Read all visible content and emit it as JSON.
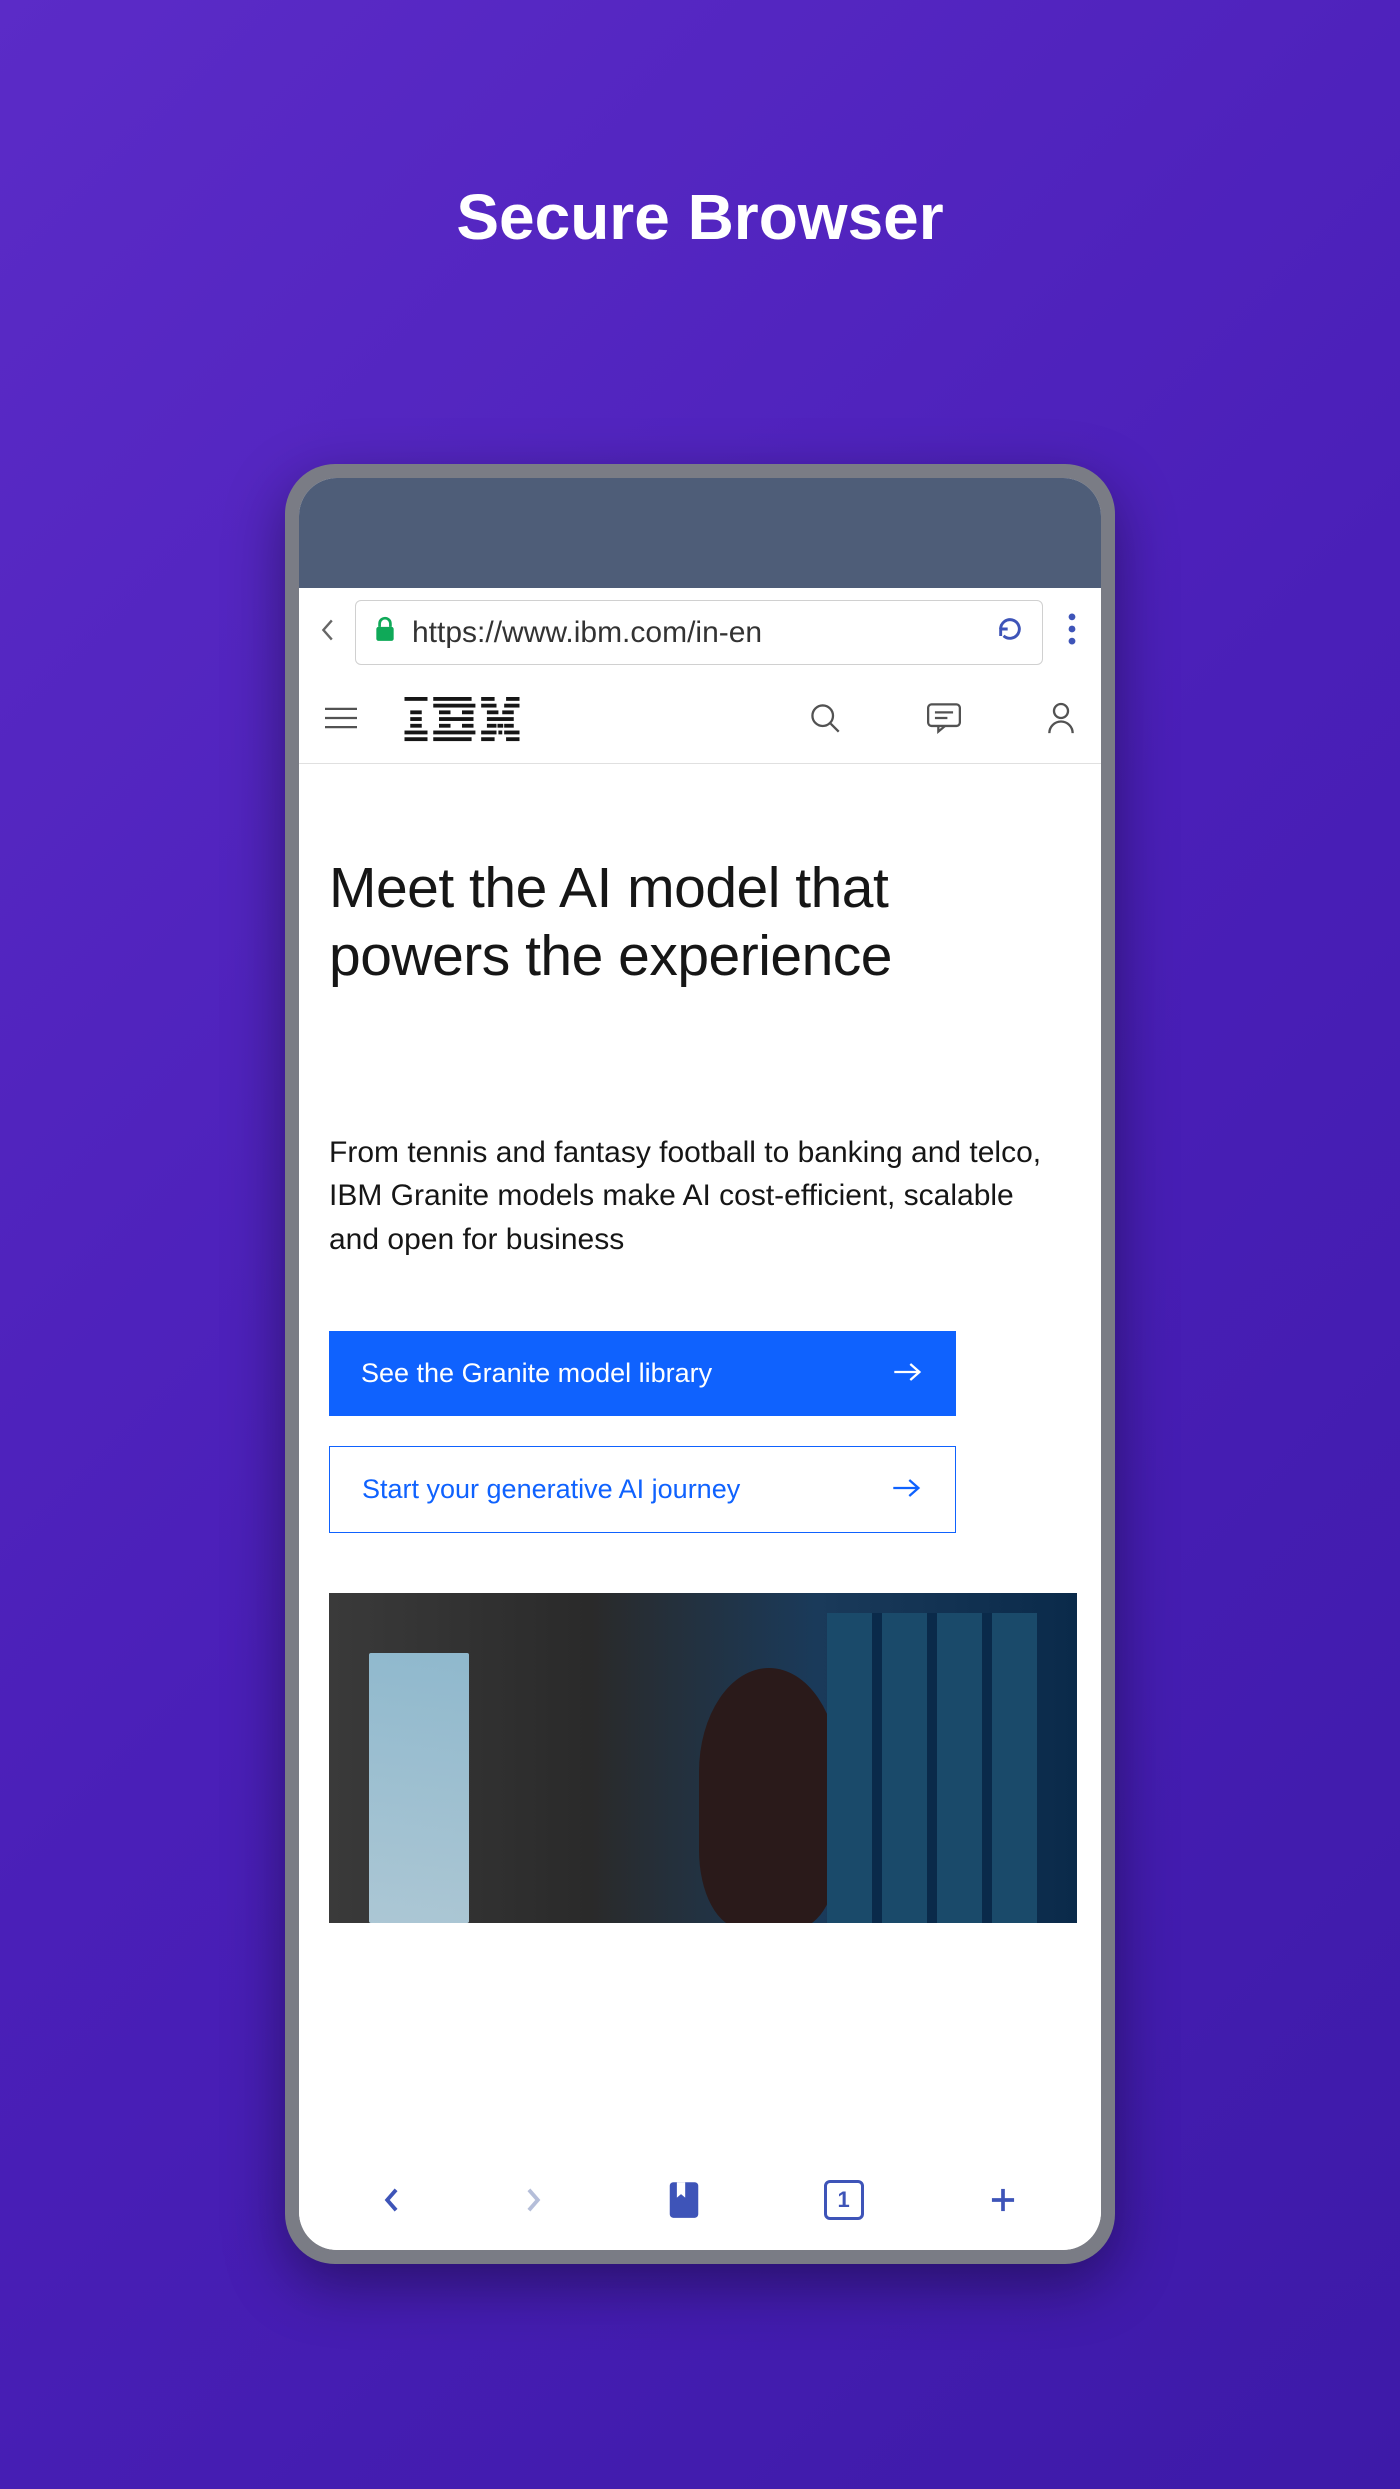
{
  "pageTitle": "Secure Browser",
  "browser": {
    "url": "https://www.ibm.com/in-en"
  },
  "site": {
    "logo": "IBM",
    "hero": {
      "heading": "Meet the AI model that powers the experience",
      "body": "From tennis and fantasy football to banking and telco, IBM Granite models make AI cost-efficient, scalable and open for business",
      "primaryCta": "See the Granite model library",
      "secondaryCta": "Start your generative AI journey"
    }
  },
  "bottomNav": {
    "tabCount": "1"
  }
}
